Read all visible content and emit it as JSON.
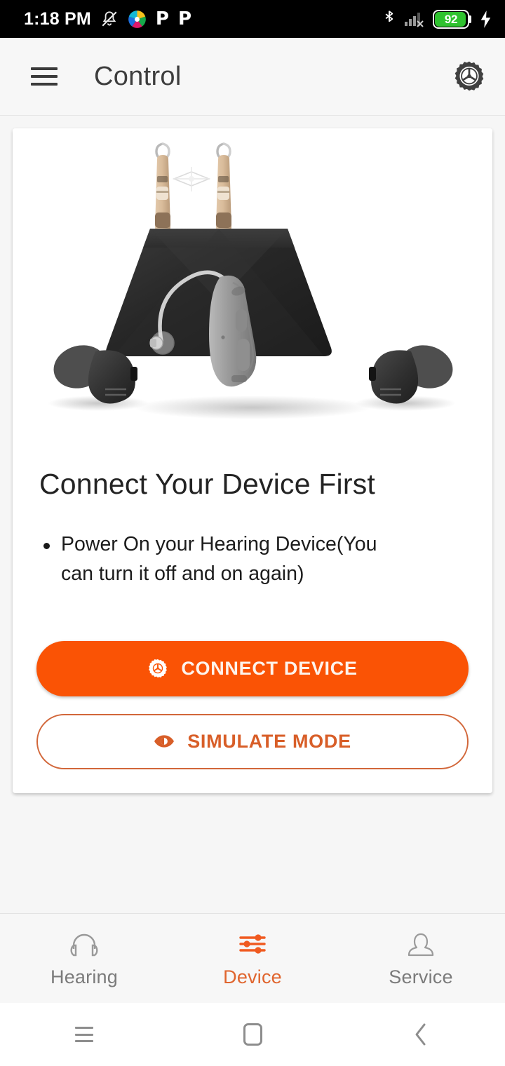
{
  "status_bar": {
    "time": "1:18 PM",
    "left_icons": [
      {
        "name": "notifications-muted-icon",
        "glyph": "bell-muted"
      },
      {
        "name": "shutter-app-icon",
        "glyph": "color-pinwheel"
      },
      {
        "name": "app-p-icon-1",
        "glyph": "P"
      },
      {
        "name": "app-p-icon-2",
        "glyph": "P"
      }
    ],
    "right_icons": [
      {
        "name": "bluetooth-icon",
        "glyph": "bluetooth"
      },
      {
        "name": "signal-no-sim-icon",
        "glyph": "signal-x"
      },
      {
        "name": "charging-bolt-icon",
        "glyph": "bolt"
      }
    ],
    "battery": {
      "level": "92",
      "color": "#2fc22f",
      "charging": true
    }
  },
  "app_bar": {
    "menu_icon": "hamburger-menu-icon",
    "title": "Control",
    "settings_icon": "gear-icon"
  },
  "card": {
    "hero_image_alt": "hearing-aids-and-charging-case",
    "heading": "Connect Your Device First",
    "bullets": [
      "Power On your Hearing Device(You can turn it off and on again)"
    ],
    "buttons": [
      {
        "name": "connect-device-button",
        "label": "CONNECT DEVICE",
        "icon": "gear-icon",
        "style": "filled",
        "color": "#fa5305"
      },
      {
        "name": "simulate-mode-button",
        "label": "SIMULATE MODE",
        "icon": "eye-icon",
        "style": "outline",
        "color": "#d85e28"
      }
    ]
  },
  "tab_bar": {
    "active": "Device",
    "tabs": [
      {
        "name": "tab-hearing",
        "label": "Hearing",
        "icon": "headphones-icon",
        "active": false
      },
      {
        "name": "tab-device",
        "label": "Device",
        "icon": "sliders-icon",
        "active": true
      },
      {
        "name": "tab-service",
        "label": "Service",
        "icon": "person-icon",
        "active": false
      }
    ]
  },
  "nav_bar": {
    "buttons": [
      {
        "name": "android-recents-button",
        "icon": "recents-icon"
      },
      {
        "name": "android-home-button",
        "icon": "home-icon"
      },
      {
        "name": "android-back-button",
        "icon": "back-chevron-icon"
      }
    ]
  },
  "colors": {
    "accent_orange": "#fa5305",
    "tab_active": "#e0652e",
    "page_bg": "#f6f6f6",
    "battery_green": "#2fc22f"
  }
}
